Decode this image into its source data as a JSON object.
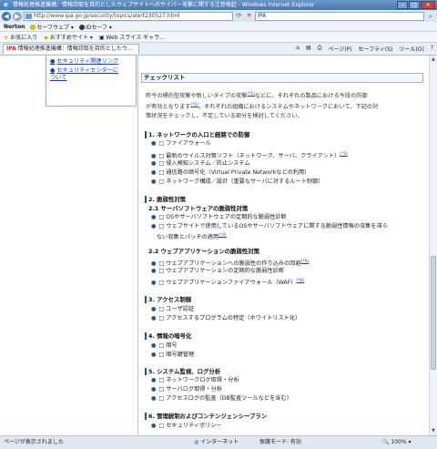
{
  "window": {
    "title": "情報処理推進機構：情報窃取を目的としたウェブサイトへのサイバー攻撃に関する注意喚起 - Windows Internet Explorer"
  },
  "address": {
    "url": "http://www.ipa.go.jp/security/topics/alert230527.html",
    "search": "IPA"
  },
  "norton_bar": {
    "brand": "Norton",
    "items": [
      "セーフウェブ",
      "IDセーフ"
    ]
  },
  "fav_bar": {
    "favorites": "お気に入り",
    "suggested": "おすすめサイト",
    "slices": "Web スライス ギャラ..."
  },
  "tab": {
    "label": "情報処理推進機構：情報窃取を目的としたウ..."
  },
  "commands": [
    "ページ(P)",
    "セーフティ(S)",
    "ツール(O)"
  ],
  "left_nav": {
    "links": [
      "セキュリティ関連リンク",
      "セキュリティセンターに",
      "ついて"
    ]
  },
  "content": {
    "section_title": "チェックリスト",
    "intro": [
      "昨今の標的型攻撃や新しいタイプの攻撃",
      "などに、それぞれの製品における今段の防御",
      "が有効となります",
      "。それぞれの組織におけるシステムやネットワークにおいて、下記の対",
      "策状況をチェックし、不足している部分を検討してください。"
    ],
    "notes": [
      "(*1)",
      "(*2)",
      "(*3)",
      "(*4)",
      "(*5)",
      "(*6)"
    ],
    "h1": "1. ネットワークの入口と経路での防御",
    "s1": [
      "□ ファイアウォール",
      "□ 最新のウイルス対策ソフト（ネットワーク、サーバ、クライアント）",
      "□ 侵入検知システム／防止システム",
      "□ 通信路の暗号化（Virtual Private Networkなどの利用）",
      "□ ネットワーク構成／設計（重要なサーバに対するルート制御）"
    ],
    "h2": "2. 脆弱性対策",
    "h21": "2.1 サーバソフトウェアの脆弱性対策",
    "s21": [
      "□ OSやサーバソフトウェアの定期的な脆弱性診断",
      "□ ウェブサイトで使用しているOSやサーバソフトウェアに関する脆弱性情報の収集を滞ら",
      "ない収集とパッチの適用"
    ],
    "h22": "2.2 ウェブアプリケーションの脆弱性対策",
    "s22": [
      "□ ウェブアプリケーションへの脆弱性の作り込みの回避",
      "□ ウェブアプリケーションの定期的な脆弱性診断",
      "□ ウェブアプリケーションファイアウォール（WAF）"
    ],
    "h3": "3. アクセス制御",
    "s3": [
      "□ ユーザ認証",
      "□ アクセスするプログラムの特定（ホワイトリスト化）"
    ],
    "h4": "4. 情報の暗号化",
    "s4": [
      "□ 暗号",
      "□ 暗号鍵管理"
    ],
    "h5": "5. システム監視、ログ分析",
    "s5": [
      "□ ネットワークログ取得・分析",
      "□ サーバログ取得・分析",
      "□ アクセスログの監査（DB監査ツールなどを含む）"
    ],
    "h6": "6. 管理統制およびコンテンジェンシープラン",
    "s6": [
      "□ セキュリティポリシー"
    ]
  },
  "status": {
    "left": "ページが表示されました",
    "zone": "インターネット",
    "protected": "保護モード: 有効",
    "zoom": "100%"
  }
}
